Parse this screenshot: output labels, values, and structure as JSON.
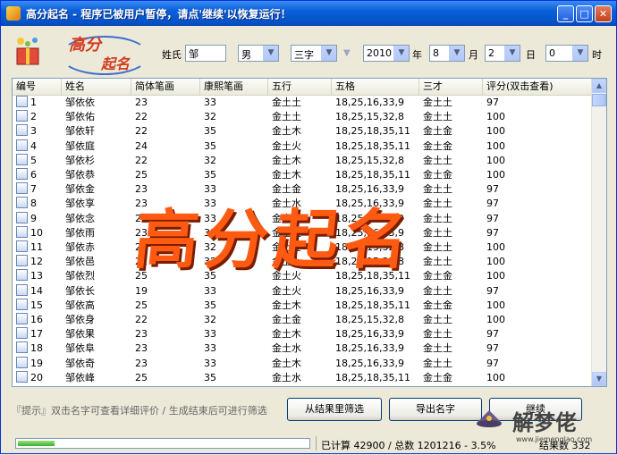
{
  "window": {
    "title": "高分起名  - 程序已被用户暂停，请点'继续'以恢复运行！",
    "controls": [
      "_",
      "□",
      "✕"
    ]
  },
  "logo": {
    "line1": "高分",
    "line2": "起名"
  },
  "form": {
    "surname_label": "姓氏",
    "surname_value": "邹",
    "gender": "男",
    "length": "三字",
    "year": "2010",
    "year_unit": "年",
    "month": "8",
    "month_unit": "月",
    "day": "2",
    "day_unit": "日",
    "hour": "0",
    "hour_unit": "时"
  },
  "table": {
    "columns": [
      "编号",
      "姓名",
      "简体笔画",
      "康熙笔画",
      "五行",
      "五格",
      "三才",
      "评分(双击查看)"
    ],
    "rows": [
      [
        "1",
        "邹依依",
        "23",
        "33",
        "金土土",
        "18,25,16,33,9",
        "金土土",
        "97"
      ],
      [
        "2",
        "邹依佑",
        "22",
        "32",
        "金土土",
        "18,25,15,32,8",
        "金土土",
        "100"
      ],
      [
        "3",
        "邹依轩",
        "22",
        "35",
        "金土木",
        "18,25,18,35,11",
        "金土金",
        "100"
      ],
      [
        "4",
        "邹依庭",
        "24",
        "35",
        "金土火",
        "18,25,18,35,11",
        "金土金",
        "100"
      ],
      [
        "5",
        "邹依杉",
        "22",
        "32",
        "金土木",
        "18,25,15,32,8",
        "金土土",
        "100"
      ],
      [
        "6",
        "邹依恭",
        "25",
        "35",
        "金土木",
        "18,25,18,35,11",
        "金土金",
        "100"
      ],
      [
        "7",
        "邹依金",
        "23",
        "33",
        "金土金",
        "18,25,16,33,9",
        "金土土",
        "97"
      ],
      [
        "8",
        "邹依享",
        "23",
        "33",
        "金土水",
        "18,25,16,33,9",
        "金土土",
        "97"
      ],
      [
        "9",
        "邹依念",
        "23",
        "33",
        "金土火",
        "18,25,16,33,9",
        "金土土",
        "97"
      ],
      [
        "10",
        "邹依雨",
        "23",
        "33",
        "金土土",
        "18,25,16,33,9",
        "金土土",
        "97"
      ],
      [
        "11",
        "邹依赤",
        "22",
        "32",
        "金土金",
        "18,25,15,32,8",
        "金土土",
        "100"
      ],
      [
        "12",
        "邹依邑",
        "22",
        "32",
        "金土土",
        "18,25,15,32,8",
        "金土土",
        "100"
      ],
      [
        "13",
        "邹依烈",
        "25",
        "35",
        "金土火",
        "18,25,18,35,11",
        "金土金",
        "100"
      ],
      [
        "14",
        "邹依长",
        "19",
        "33",
        "金土火",
        "18,25,16,33,9",
        "金土土",
        "97"
      ],
      [
        "15",
        "邹依高",
        "25",
        "35",
        "金土木",
        "18,25,18,35,11",
        "金土金",
        "100"
      ],
      [
        "16",
        "邹依身",
        "22",
        "32",
        "金土金",
        "18,25,15,32,8",
        "金土土",
        "100"
      ],
      [
        "17",
        "邹依果",
        "23",
        "33",
        "金土木",
        "18,25,16,33,9",
        "金土土",
        "97"
      ],
      [
        "18",
        "邹依阜",
        "23",
        "33",
        "金土水",
        "18,25,16,33,9",
        "金土土",
        "97"
      ],
      [
        "19",
        "邹依奇",
        "23",
        "33",
        "金土木",
        "18,25,16,33,9",
        "金土土",
        "97"
      ],
      [
        "20",
        "邹依峰",
        "25",
        "35",
        "金土水",
        "18,25,18,35,11",
        "金土金",
        "100"
      ]
    ]
  },
  "hint": "『提示』双击名字可查看详细评价 / 生成结束后可进行筛选",
  "buttons": {
    "filter": "从结果里筛选",
    "export": "导出名字",
    "continue": "继续"
  },
  "status": {
    "progress_fraction": 0.036,
    "counts": "已计算 42900 / 总数 1201216 - 3.5%",
    "results": "结果数 332"
  },
  "watermark": "高分起名",
  "corner_logo": {
    "text": "解梦佬",
    "small": "www.jiemenglao.com"
  },
  "colors": {
    "title_bar": "#0a5fd8",
    "watermark": "#ff5a12",
    "accent": "#d23b1f"
  }
}
